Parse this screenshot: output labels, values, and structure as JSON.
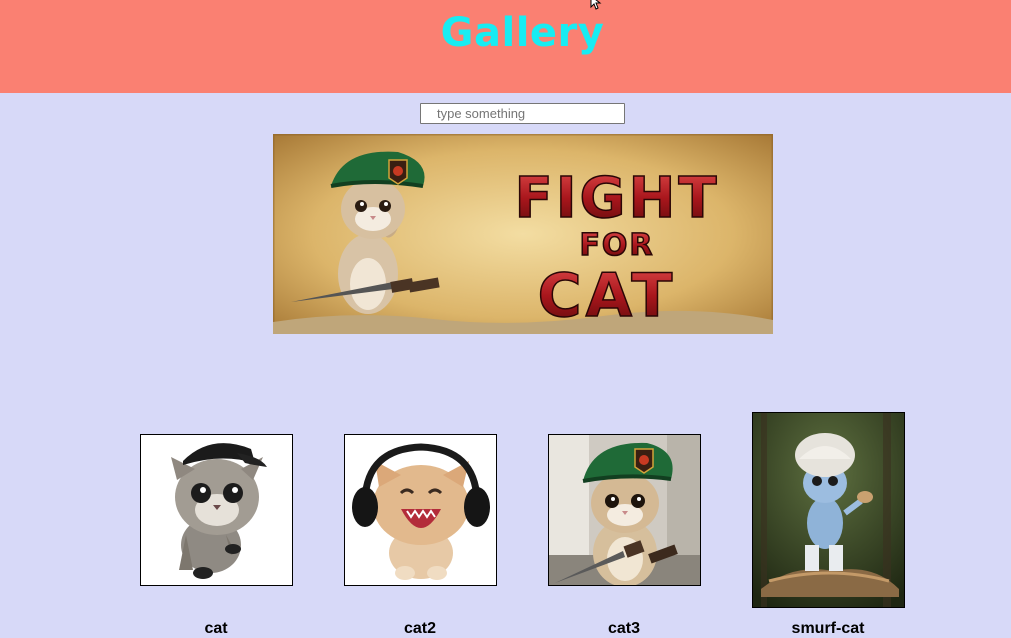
{
  "header": {
    "title": "Gallery",
    "background": "#fa8072",
    "title_color": "#18ecf2"
  },
  "search": {
    "placeholder": "type something",
    "value": ""
  },
  "banner": {
    "alt": "FIGHT FOR CAT banner",
    "line1": "FIGHT",
    "line2": "FOR",
    "line3": "CAT"
  },
  "gallery": {
    "items": [
      {
        "caption": "cat",
        "image": "kitten-with-cap"
      },
      {
        "caption": "cat2",
        "image": "kitten-with-headphones"
      },
      {
        "caption": "cat3",
        "image": "kitten-with-beret-and-knife"
      },
      {
        "caption": "smurf-cat",
        "image": "smurf-cat-on-mushroom"
      }
    ]
  },
  "colors": {
    "page_background": "#d7d9f8",
    "header_background": "#fa8072",
    "title": "#18ecf2"
  }
}
